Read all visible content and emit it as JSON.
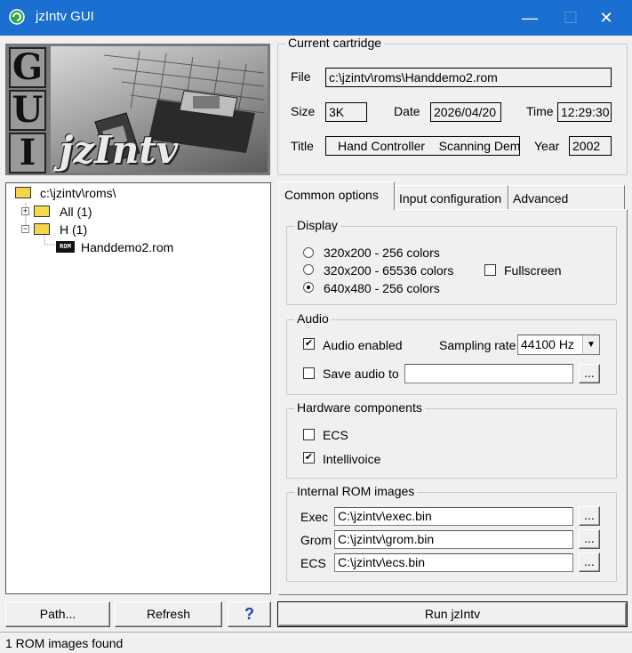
{
  "window": {
    "title": "jzIntv GUI",
    "minimize": "—",
    "maximize": "☐",
    "close": "✕"
  },
  "logo": {
    "letters": [
      "G",
      "U",
      "I"
    ],
    "text": "jzIntv"
  },
  "cartridge": {
    "group_label": "Current cartridge",
    "file_label": "File",
    "file_value": "c:\\jzintv\\roms\\Handdemo2.rom",
    "size_label": "Size",
    "size_value": "3K",
    "date_label": "Date",
    "date_value": "2026/04/20",
    "time_label": "Time",
    "time_value": "12:29:30",
    "title_label": "Title",
    "title_value": "Hand Controller    Scanning Demo",
    "year_label": "Year",
    "year_value": "2002"
  },
  "tree": {
    "root": "c:\\jzintv\\roms\\",
    "all": "All (1)",
    "h": "H (1)",
    "rom_badge": "ROM",
    "file": "Handdemo2.rom"
  },
  "tabs": [
    "Common options",
    "Input configuration",
    "Advanced"
  ],
  "display": {
    "label": "Display",
    "options": [
      "320x200 - 256 colors",
      "320x200 - 65536 colors",
      "640x480 - 256 colors"
    ],
    "selected_index": 2,
    "fullscreen_label": "Fullscreen",
    "fullscreen_checked": false
  },
  "audio": {
    "label": "Audio",
    "enabled_label": "Audio enabled",
    "enabled_checked": true,
    "rate_label": "Sampling rate",
    "rate_value": "44100 Hz",
    "save_label": "Save audio to",
    "save_checked": false,
    "save_value": "",
    "browse": "..."
  },
  "hardware": {
    "label": "Hardware components",
    "ecs_label": "ECS",
    "ecs_checked": false,
    "intellivoice_label": "Intellivoice",
    "intellivoice_checked": true
  },
  "rom_images": {
    "label": "Internal ROM images",
    "exec_label": "Exec",
    "exec_value": "C:\\jzintv\\exec.bin",
    "grom_label": "Grom",
    "grom_value": "C:\\jzintv\\grom.bin",
    "ecs_label": "ECS",
    "ecs_value": "C:\\jzintv\\ecs.bin",
    "browse": "..."
  },
  "buttons": {
    "path": "Path...",
    "refresh": "Refresh",
    "help": "?",
    "run": "Run jzIntv"
  },
  "status": "1 ROM images found",
  "colors": {
    "titlebar": "#1a6fd0",
    "help": "#1f3fbf"
  }
}
